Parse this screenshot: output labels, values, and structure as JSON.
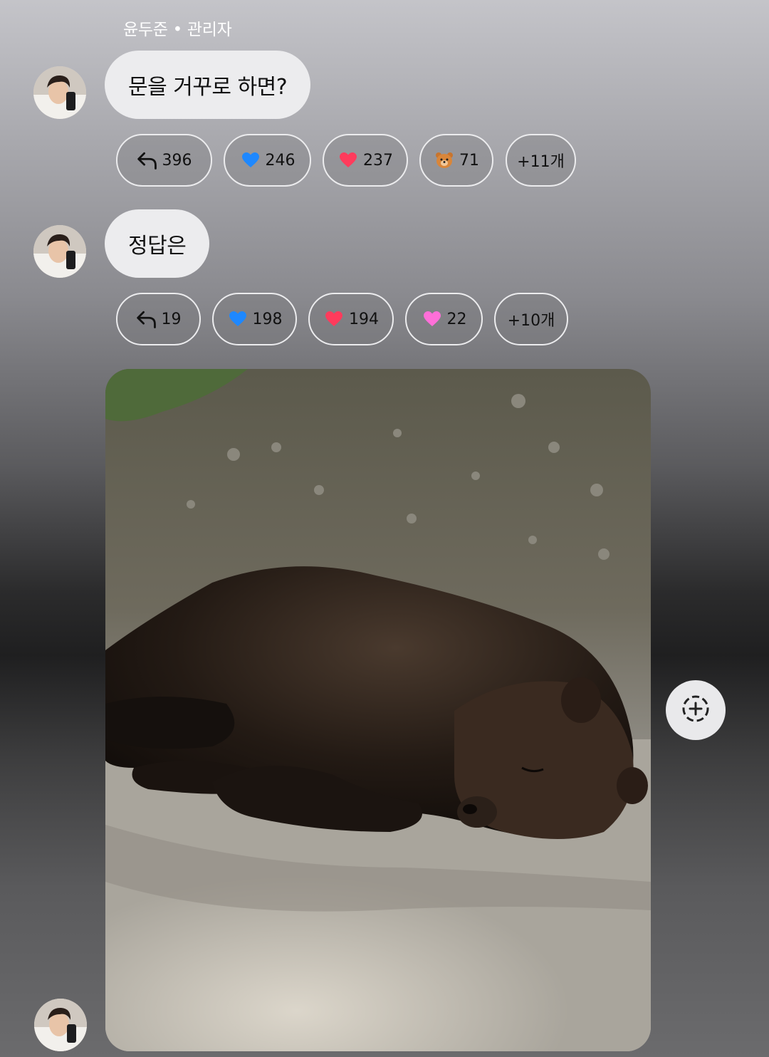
{
  "sender": {
    "name_role": "윤두준 • 관리자"
  },
  "messages": [
    {
      "text": "문을 거꾸로 하면?",
      "reactions": [
        {
          "icon": "reply-arrow-icon",
          "count": "396"
        },
        {
          "icon": "blue-heart-icon",
          "count": "246"
        },
        {
          "icon": "red-heart-icon",
          "count": "237"
        },
        {
          "icon": "bear-face-icon",
          "count": "71"
        },
        {
          "more": "+11개"
        }
      ]
    },
    {
      "text": "정답은",
      "reactions": [
        {
          "icon": "reply-arrow-icon",
          "count": "19"
        },
        {
          "icon": "blue-heart-icon",
          "count": "198"
        },
        {
          "icon": "red-heart-icon",
          "count": "194"
        },
        {
          "icon": "pink-heart-icon",
          "count": "22"
        },
        {
          "more": "+10개"
        }
      ]
    }
  ],
  "image_message": {
    "description_icon": "sleeping-bear-photo"
  },
  "actions": {
    "add_reaction_icon": "add-reaction-icon"
  },
  "colors": {
    "bubble": "#ececee",
    "blue_heart": "#1e88ff",
    "red_heart": "#ff3b5c",
    "pink_heart": "#ff6fd8"
  }
}
